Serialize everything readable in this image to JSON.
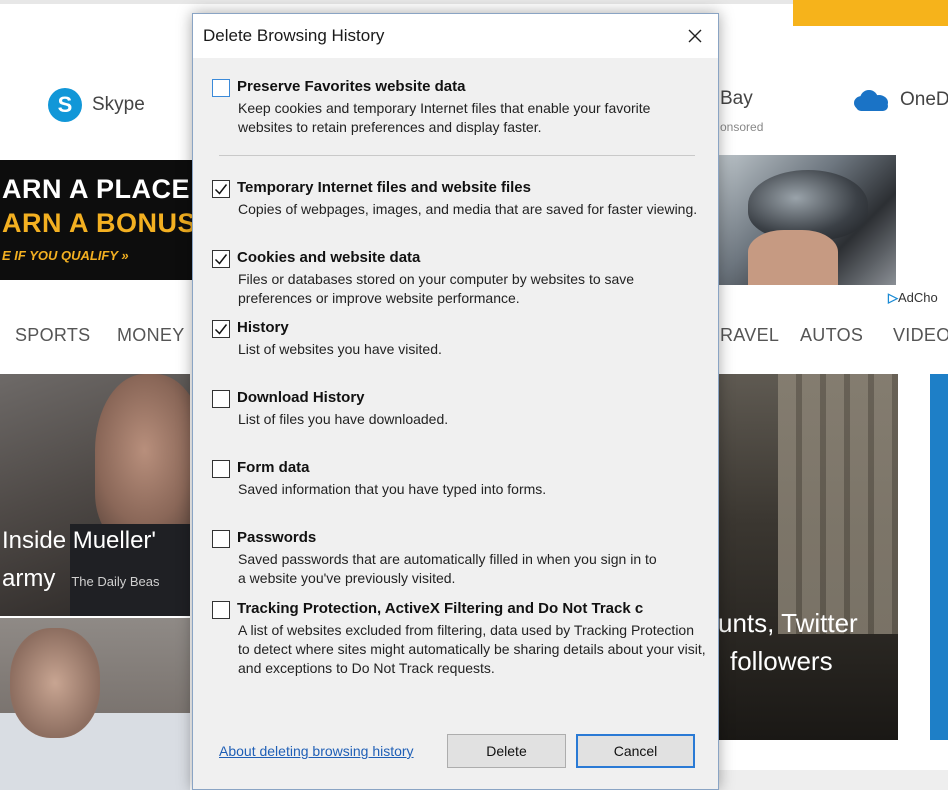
{
  "background": {
    "quicklinks": [
      {
        "label": "Skype",
        "icon": "skype-icon",
        "icon_glyph": "S"
      },
      {
        "label": "Bay",
        "icon": "ebay-icon"
      },
      {
        "label": "OneDr",
        "icon": "onedrive-icon"
      }
    ],
    "sponsored": "onsored",
    "ad_left": {
      "line1": "ARN A PLACE",
      "line2": "ARN A BONUS",
      "line3": "E IF YOU QUALIFY »"
    },
    "adchoices": "AdCho",
    "adchoices_glyph": "▷",
    "nav": [
      "SPORTS",
      "MONEY",
      "RAVEL",
      "AUTOS",
      "VIDEO"
    ],
    "news": [
      {
        "headline_l1": "Inside Mueller'",
        "headline_l2": "army",
        "source": "The Daily Beas"
      },
      {
        "headline_l1": "unts, Twitter",
        "headline_l2": "followers"
      }
    ],
    "colors": {
      "accent_orange": "#f6b31b",
      "ad_gold": "#f3b021",
      "onedrive_blue": "#1a73c6",
      "skype_blue": "#1197d8"
    }
  },
  "dialog": {
    "title": "Delete Browsing History",
    "close_icon": "close-icon",
    "options": [
      {
        "label": "Preserve Favorites website data",
        "checked": false,
        "desc": "Keep cookies and temporary Internet files that enable your favorite websites to retain preferences and display faster."
      },
      {
        "label": "Temporary Internet files and website files",
        "checked": true,
        "desc": "Copies of webpages, images, and media that are saved for faster viewing."
      },
      {
        "label": "Cookies and website data",
        "checked": true,
        "desc": "Files or databases stored on your computer by websites to save preferences or improve website performance."
      },
      {
        "label": "History",
        "checked": true,
        "desc": "List of websites you have visited."
      },
      {
        "label": "Download History",
        "checked": false,
        "desc": "List of files you have downloaded."
      },
      {
        "label": "Form data",
        "checked": false,
        "desc": "Saved information that you have typed into forms."
      },
      {
        "label": "Passwords",
        "checked": false,
        "desc": "Saved passwords that are automatically filled in when you sign in to a website you've previously visited."
      },
      {
        "label": "Tracking Protection, ActiveX Filtering and Do Not Track c",
        "checked": false,
        "desc": "A list of websites excluded from filtering, data used by Tracking Protection to detect where sites might automatically be sharing details about your visit, and exceptions to Do Not Track requests."
      }
    ],
    "about_link": "About deleting browsing history",
    "delete_label": "Delete",
    "cancel_label": "Cancel",
    "colors": {
      "border": "#8aa4c4",
      "focus": "#2a7ad5",
      "link": "#1f5fb6"
    }
  }
}
